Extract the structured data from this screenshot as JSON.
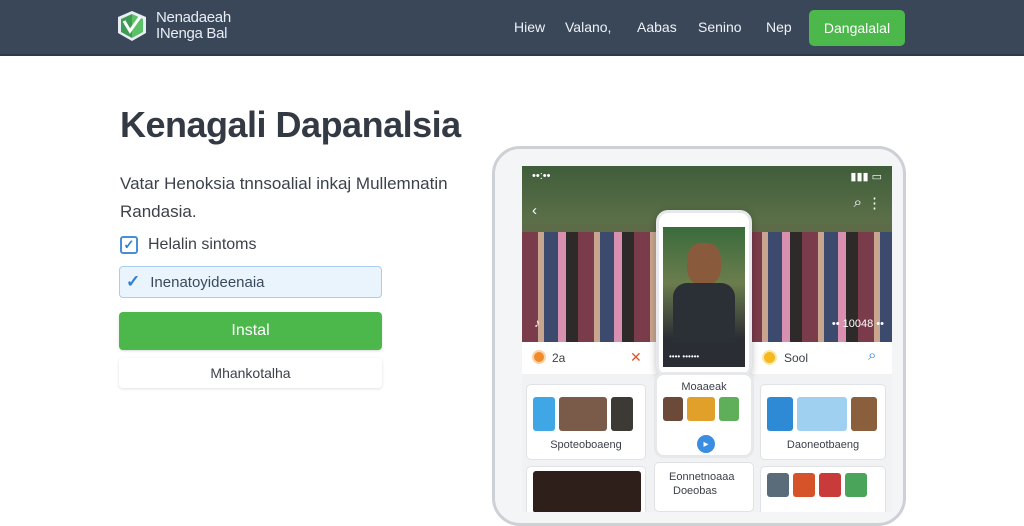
{
  "header": {
    "brand_line1": "Nenadaeah",
    "brand_line2": "INenga Bal",
    "nav": [
      "Hiew",
      "Valano,",
      "Aabas",
      "Senino",
      "Nep"
    ],
    "cta": "Dangalalal"
  },
  "hero": {
    "title": "Kenagali Dapanalsia",
    "description": "Vatar Henoksia tnnsoalial inkaj Mullemnatin Randasia.",
    "checkbox_label": "Helalin sintoms",
    "checkbox_checked": true,
    "selected_option": "Inenatoyideenaia",
    "install_button": "Instal",
    "secondary_button": "Mhankotalha"
  },
  "phone": {
    "status_left": "••:••",
    "video_caption": "•• 10048 ••",
    "likes": "2a",
    "username": "Sool",
    "inner_caption": "•••• ••••••",
    "cards": [
      {
        "label": "Spoteoboaeng"
      },
      {
        "label": "Moaaeak"
      },
      {
        "label": "Daoneotbaeng"
      }
    ],
    "bottom_text_1": "Eonnetnoaaa",
    "bottom_text_2": "Doeobas"
  },
  "colors": {
    "topbar": "#3a4759",
    "accent_green": "#4cb74a",
    "accent_blue": "#2f7fd3"
  }
}
